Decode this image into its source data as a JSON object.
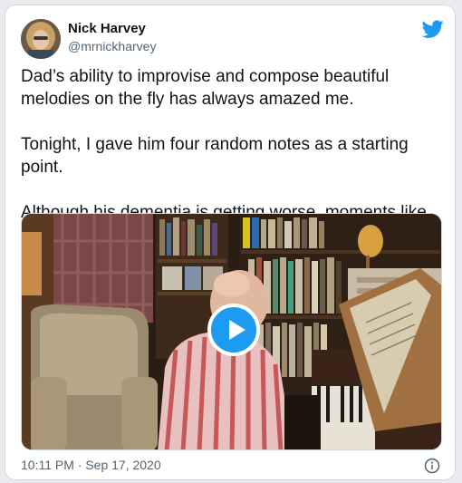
{
  "author": {
    "name": "Nick Harvey",
    "handle": "@mrnickharvey"
  },
  "tweet": {
    "paragraphs": [
      "Dad’s ability to improvise and compose beautiful melodies on the fly has always amazed me.",
      "Tonight, I gave him four random notes as a starting point.",
      "Although his dementia is getting worse, moments like this bring him back to me."
    ],
    "timestamp": "10:11 PM · Sep 17, 2020"
  },
  "icons": {
    "brand": "twitter-bird-icon",
    "play": "play-icon",
    "info": "info-icon"
  },
  "colors": {
    "brand": "#1d9bf0",
    "text": "#0f1419",
    "secondary": "#536471",
    "border": "#cfd9de"
  }
}
